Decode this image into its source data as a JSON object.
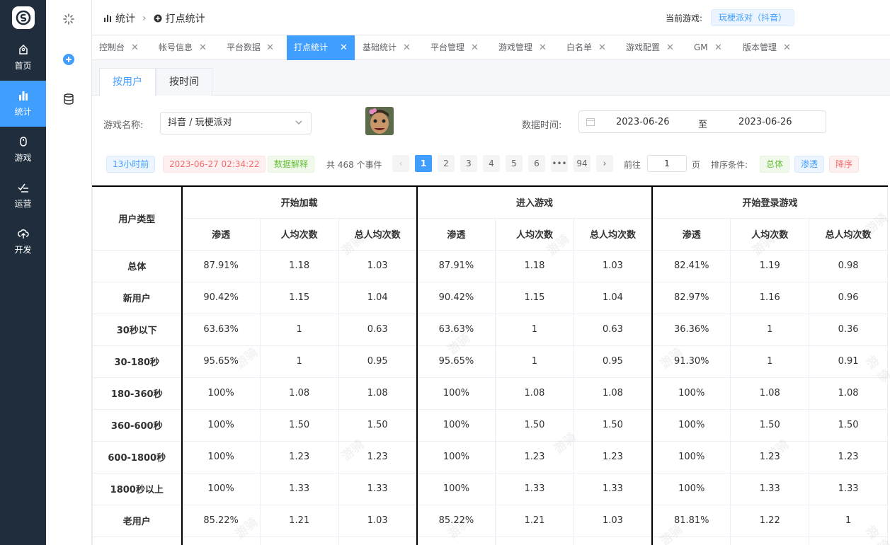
{
  "sidebar": {
    "items": [
      {
        "label": "首页",
        "icon": "home-icon"
      },
      {
        "label": "统计",
        "icon": "bar-chart-icon",
        "active": true
      },
      {
        "label": "游戏",
        "icon": "gamepad-icon"
      },
      {
        "label": "运营",
        "icon": "operation-icon"
      },
      {
        "label": "开发",
        "icon": "cloud-upload-icon"
      }
    ]
  },
  "header": {
    "breadcrumb": [
      "统计",
      "打点统计"
    ],
    "current_game_label": "当前游戏:",
    "current_game": "玩梗派对（抖音）"
  },
  "tags": [
    {
      "label": "控制台"
    },
    {
      "label": "帐号信息"
    },
    {
      "label": "平台数据"
    },
    {
      "label": "打点统计",
      "active": true
    },
    {
      "label": "基础统计"
    },
    {
      "label": "平台管理"
    },
    {
      "label": "游戏管理"
    },
    {
      "label": "白名单"
    },
    {
      "label": "游戏配置"
    },
    {
      "label": "GM"
    },
    {
      "label": "版本管理"
    }
  ],
  "subtabs": [
    {
      "label": "按用户",
      "active": true
    },
    {
      "label": "按时间"
    }
  ],
  "filters": {
    "game_label": "游戏名称:",
    "game_value": "抖音 / 玩梗派对",
    "time_label": "数据时间:",
    "date_start": "2023-06-26",
    "date_sep": "至",
    "date_end": "2023-06-26"
  },
  "info": {
    "updated_ago": "13小时前",
    "updated_at": "2023-06-27 02:34:22",
    "explain": "数据解释",
    "total": "共 468 个事件"
  },
  "pagination": {
    "pages": [
      "1",
      "2",
      "3",
      "4",
      "5",
      "6",
      "•••",
      "94"
    ],
    "current": "1",
    "goto_label": "前往",
    "goto_value": "1",
    "unit": "页"
  },
  "sort": {
    "label": "排序条件:",
    "options": [
      "总体",
      "渗透",
      "降序"
    ]
  },
  "table": {
    "row_header": "用户类型",
    "groups": [
      "开始加载",
      "进入游戏",
      "开始登录游戏"
    ],
    "sub_headers": [
      "渗透",
      "人均次数",
      "总人均次数"
    ],
    "rows": [
      {
        "type": "总体",
        "v": [
          "87.91%",
          "1.18",
          "1.03",
          "87.91%",
          "1.18",
          "1.03",
          "82.41%",
          "1.19",
          "0.98"
        ]
      },
      {
        "type": "新用户",
        "v": [
          "90.42%",
          "1.15",
          "1.04",
          "90.42%",
          "1.15",
          "1.04",
          "82.97%",
          "1.16",
          "0.96"
        ]
      },
      {
        "type": "30秒以下",
        "v": [
          "63.63%",
          "1",
          "0.63",
          "63.63%",
          "1",
          "0.63",
          "36.36%",
          "1",
          "0.36"
        ]
      },
      {
        "type": "30-180秒",
        "v": [
          "95.65%",
          "1",
          "0.95",
          "95.65%",
          "1",
          "0.95",
          "91.30%",
          "1",
          "0.91"
        ]
      },
      {
        "type": "180-360秒",
        "v": [
          "100%",
          "1.08",
          "1.08",
          "100%",
          "1.08",
          "1.08",
          "100%",
          "1.08",
          "1.08"
        ]
      },
      {
        "type": "360-600秒",
        "v": [
          "100%",
          "1.50",
          "1.50",
          "100%",
          "1.50",
          "1.50",
          "100%",
          "1.50",
          "1.50"
        ]
      },
      {
        "type": "600-1800秒",
        "v": [
          "100%",
          "1.23",
          "1.23",
          "100%",
          "1.23",
          "1.23",
          "100%",
          "1.23",
          "1.23"
        ]
      },
      {
        "type": "1800秒以上",
        "v": [
          "100%",
          "1.33",
          "1.33",
          "100%",
          "1.33",
          "1.33",
          "100%",
          "1.33",
          "1.33"
        ]
      },
      {
        "type": "老用户",
        "v": [
          "85.22%",
          "1.21",
          "1.03",
          "85.22%",
          "1.21",
          "1.03",
          "81.81%",
          "1.22",
          "1"
        ]
      }
    ]
  },
  "watermark": "游骑"
}
